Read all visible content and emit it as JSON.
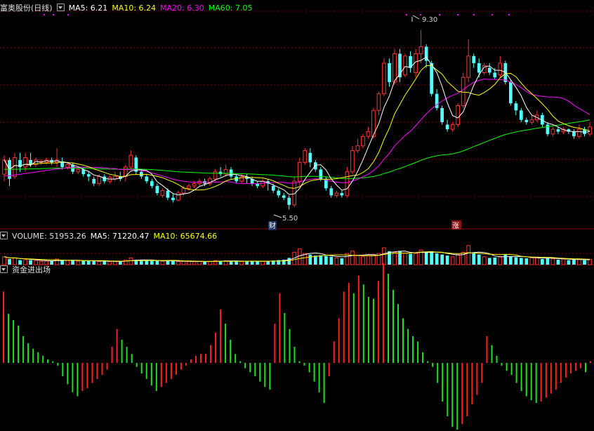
{
  "theme": {
    "up": "#ff3232",
    "down": "#54ffff",
    "ma5": "#ffffff",
    "ma10": "#ffff00",
    "ma20": "#ff00ff",
    "ma60": "#00ff00",
    "grid": "#8b0000",
    "fund_up": "#ff2020",
    "fund_down": "#20e020"
  },
  "header": {
    "title": "富奥股份(日线)",
    "ma5": "MA5: 6.21",
    "ma10": "MA10: 6.24",
    "ma20": "MA20: 6.30",
    "ma60": "MA60: 7.05"
  },
  "volume_header": {
    "title": "VOLUME: 51953.26",
    "ma5": "MA5: 71220.47",
    "ma10": "MA10: 65674.66"
  },
  "fund_header": {
    "title": "资金进出场"
  },
  "chart_data": {
    "type": "candlestick",
    "price_range": [
      5.3,
      9.7
    ],
    "annotations": {
      "high_label": "9.30",
      "low_label": "5.50",
      "badge_cai": "财",
      "badge_zhang": "涨"
    },
    "candles": [
      [
        6.25,
        6.55,
        6.65,
        6.1
      ],
      [
        6.55,
        6.15,
        6.6,
        6.0
      ],
      [
        6.2,
        6.6,
        6.7,
        6.15
      ],
      [
        6.55,
        6.4,
        6.7,
        6.3
      ],
      [
        6.4,
        6.6,
        6.7,
        6.3
      ],
      [
        6.55,
        6.45,
        6.7,
        6.4
      ],
      [
        6.45,
        6.55,
        6.6,
        6.4
      ],
      [
        6.5,
        6.52,
        6.56,
        6.45
      ],
      [
        6.5,
        6.55,
        6.6,
        6.45
      ],
      [
        6.55,
        6.5,
        6.6,
        6.45
      ],
      [
        6.5,
        6.55,
        6.8,
        6.4
      ],
      [
        6.52,
        6.4,
        6.6,
        6.35
      ],
      [
        6.4,
        6.45,
        6.5,
        6.35
      ],
      [
        6.45,
        6.3,
        6.5,
        6.25
      ],
      [
        6.3,
        6.35,
        6.4,
        6.25
      ],
      [
        6.35,
        6.25,
        6.4,
        6.2
      ],
      [
        6.25,
        6.2,
        6.3,
        6.1
      ],
      [
        6.15,
        6.05,
        6.2,
        6.0
      ],
      [
        6.05,
        6.2,
        6.25,
        6.0
      ],
      [
        6.2,
        6.1,
        6.25,
        6.05
      ],
      [
        6.1,
        6.18,
        6.22,
        6.05
      ],
      [
        6.15,
        6.2,
        6.3,
        6.1
      ],
      [
        6.2,
        6.15,
        6.3,
        6.1
      ],
      [
        6.2,
        6.4,
        6.45,
        6.1
      ],
      [
        6.4,
        6.65,
        6.75,
        6.35
      ],
      [
        6.6,
        6.3,
        6.65,
        6.25
      ],
      [
        6.3,
        6.2,
        6.35,
        6.15
      ],
      [
        6.2,
        6.1,
        6.25,
        6.05
      ],
      [
        6.1,
        6.0,
        6.15,
        5.95
      ],
      [
        6.0,
        5.85,
        6.05,
        5.8
      ],
      [
        5.8,
        5.9,
        5.95,
        5.75
      ],
      [
        5.9,
        5.75,
        5.95,
        5.7
      ],
      [
        5.75,
        5.7,
        5.85,
        5.65
      ],
      [
        5.7,
        5.85,
        5.9,
        5.68
      ],
      [
        5.85,
        5.95,
        6.0,
        5.8
      ],
      [
        5.95,
        6.0,
        6.05,
        5.9
      ],
      [
        6.0,
        6.05,
        6.1,
        5.95
      ],
      [
        6.05,
        6.1,
        6.15,
        6.0
      ],
      [
        6.1,
        6.05,
        6.15,
        6.0
      ],
      [
        6.05,
        6.15,
        6.2,
        6.0
      ],
      [
        6.15,
        6.3,
        6.35,
        6.1
      ],
      [
        6.3,
        6.25,
        6.4,
        6.2
      ],
      [
        6.25,
        6.35,
        6.45,
        6.2
      ],
      [
        6.35,
        6.2,
        6.4,
        6.15
      ],
      [
        6.2,
        6.1,
        6.25,
        6.05
      ],
      [
        6.1,
        6.2,
        6.25,
        6.05
      ],
      [
        6.2,
        6.15,
        6.25,
        6.05
      ],
      [
        6.15,
        6.05,
        6.2,
        6.0
      ],
      [
        6.05,
        6.0,
        6.1,
        5.95
      ],
      [
        6.0,
        6.1,
        6.15,
        5.95
      ],
      [
        6.1,
        6.05,
        6.15,
        5.9
      ],
      [
        6.0,
        5.9,
        6.05,
        5.85
      ],
      [
        5.9,
        5.8,
        5.95,
        5.75
      ],
      [
        5.8,
        5.75,
        5.85,
        5.7
      ],
      [
        5.75,
        5.6,
        5.8,
        5.5
      ],
      [
        5.6,
        6.1,
        6.2,
        5.55
      ],
      [
        6.1,
        6.5,
        6.6,
        6.0
      ],
      [
        6.5,
        6.75,
        6.8,
        6.45
      ],
      [
        6.7,
        6.5,
        6.8,
        6.4
      ],
      [
        6.5,
        6.35,
        6.55,
        6.3
      ],
      [
        6.35,
        6.15,
        6.4,
        6.1
      ],
      [
        6.15,
        5.95,
        6.2,
        5.9
      ],
      [
        5.95,
        5.8,
        6.0,
        5.75
      ],
      [
        5.8,
        5.85,
        5.9,
        5.75
      ],
      [
        5.85,
        5.8,
        5.9,
        5.75
      ],
      [
        5.8,
        6.3,
        6.4,
        5.75
      ],
      [
        6.3,
        6.75,
        6.85,
        6.25
      ],
      [
        6.75,
        6.85,
        7.0,
        6.7
      ],
      [
        6.85,
        7.05,
        7.1,
        6.8
      ],
      [
        7.05,
        7.15,
        7.25,
        7.0
      ],
      [
        7.05,
        7.6,
        7.65,
        7.0
      ],
      [
        7.6,
        7.95,
        8.0,
        7.5
      ],
      [
        7.95,
        8.6,
        8.7,
        7.9
      ],
      [
        8.6,
        8.2,
        8.7,
        8.1
      ],
      [
        8.2,
        8.8,
        8.9,
        8.15
      ],
      [
        8.8,
        8.3,
        8.9,
        8.2
      ],
      [
        8.35,
        8.75,
        8.8,
        8.3
      ],
      [
        8.75,
        8.5,
        8.85,
        8.4
      ],
      [
        8.4,
        8.8,
        8.9,
        8.3
      ],
      [
        8.8,
        8.95,
        9.3,
        8.6
      ],
      [
        8.95,
        8.65,
        9.0,
        8.5
      ],
      [
        8.6,
        7.95,
        8.65,
        7.9
      ],
      [
        7.95,
        7.65,
        8.05,
        7.6
      ],
      [
        7.65,
        7.35,
        7.7,
        7.3
      ],
      [
        7.3,
        7.2,
        7.4,
        7.15
      ],
      [
        7.2,
        7.3,
        7.35,
        7.15
      ],
      [
        7.3,
        7.7,
        7.75,
        7.25
      ],
      [
        7.7,
        8.3,
        8.4,
        7.65
      ],
      [
        8.3,
        8.75,
        9.1,
        8.2
      ],
      [
        8.75,
        8.6,
        8.8,
        8.5
      ],
      [
        8.6,
        8.4,
        8.7,
        8.3
      ],
      [
        8.4,
        8.55,
        8.6,
        8.35
      ],
      [
        8.5,
        8.4,
        8.6,
        8.35
      ],
      [
        8.4,
        8.3,
        8.5,
        8.25
      ],
      [
        8.35,
        8.6,
        8.75,
        8.3
      ],
      [
        8.6,
        8.2,
        8.65,
        8.15
      ],
      [
        8.2,
        7.75,
        8.25,
        7.7
      ],
      [
        7.75,
        7.6,
        7.8,
        7.5
      ],
      [
        7.6,
        7.4,
        7.65,
        7.35
      ],
      [
        7.4,
        7.35,
        7.45,
        7.3
      ],
      [
        7.35,
        7.4,
        7.5,
        7.3
      ],
      [
        7.4,
        7.5,
        7.6,
        7.35
      ],
      [
        7.5,
        7.3,
        7.55,
        7.25
      ],
      [
        7.3,
        7.1,
        7.35,
        7.05
      ],
      [
        7.1,
        7.2,
        7.25,
        7.05
      ],
      [
        7.2,
        7.15,
        7.25,
        7.1
      ],
      [
        7.15,
        7.2,
        7.25,
        7.1
      ],
      [
        7.2,
        7.15,
        7.22,
        7.1
      ],
      [
        7.15,
        7.05,
        7.2,
        7.0
      ],
      [
        7.05,
        7.2,
        7.3,
        7.0
      ],
      [
        7.2,
        7.1,
        7.25,
        7.05
      ],
      [
        7.1,
        7.25,
        7.35,
        7.05
      ]
    ],
    "volume": [
      0.35,
      0.25,
      0.3,
      0.2,
      0.22,
      0.2,
      0.18,
      0.15,
      0.16,
      0.17,
      0.25,
      0.2,
      0.18,
      0.2,
      0.15,
      0.17,
      0.16,
      0.18,
      0.14,
      0.15,
      0.14,
      0.13,
      0.14,
      0.2,
      0.3,
      0.22,
      0.18,
      0.17,
      0.16,
      0.2,
      0.15,
      0.17,
      0.15,
      0.14,
      0.15,
      0.14,
      0.13,
      0.14,
      0.13,
      0.15,
      0.18,
      0.16,
      0.17,
      0.15,
      0.16,
      0.14,
      0.15,
      0.16,
      0.14,
      0.15,
      0.16,
      0.18,
      0.2,
      0.22,
      0.3,
      0.55,
      0.7,
      0.5,
      0.45,
      0.4,
      0.42,
      0.38,
      0.35,
      0.3,
      0.28,
      0.5,
      0.6,
      0.4,
      0.35,
      0.4,
      0.45,
      0.5,
      0.75,
      0.6,
      0.55,
      0.58,
      0.52,
      0.48,
      0.5,
      0.65,
      0.55,
      0.6,
      0.5,
      0.45,
      0.4,
      0.35,
      0.45,
      0.55,
      0.85,
      0.5,
      0.45,
      0.35,
      0.3,
      0.32,
      0.35,
      0.45,
      0.38,
      0.33,
      0.3,
      0.28,
      0.3,
      0.32,
      0.25,
      0.3,
      0.26,
      0.22,
      0.25,
      0.2,
      0.22,
      0.24,
      0.2,
      0.23
    ],
    "fund_flow": [
      0.8,
      0.55,
      0.48,
      0.42,
      0.3,
      0.22,
      0.16,
      0.12,
      0.08,
      0.04,
      0.02,
      -0.04,
      -0.2,
      -0.32,
      -0.44,
      -0.5,
      -0.42,
      -0.38,
      -0.3,
      -0.24,
      -0.18,
      -0.1,
      0.18,
      0.38,
      0.26,
      0.18,
      0.1,
      -0.06,
      -0.16,
      -0.24,
      -0.34,
      -0.42,
      -0.36,
      -0.3,
      -0.24,
      -0.18,
      -0.1,
      -0.04,
      0.04,
      0.08,
      0.1,
      0.1,
      0.2,
      0.34,
      0.6,
      0.44,
      0.26,
      0.1,
      0.02,
      -0.08,
      -0.14,
      -0.2,
      -0.28,
      -0.36,
      -0.4,
      0.44,
      0.78,
      0.56,
      0.38,
      0.18,
      0.02,
      -0.04,
      -0.14,
      -0.28,
      -0.44,
      -0.6,
      -0.2,
      0.24,
      0.5,
      0.8,
      0.9,
      0.78,
      0.98,
      0.88,
      0.74,
      0.72,
      0.92,
      1.12,
      1.0,
      0.82,
      0.66,
      0.5,
      0.38,
      0.3,
      0.24,
      0.12,
      0.02,
      -0.06,
      -0.3,
      -0.58,
      -0.8,
      -0.96,
      -1.0,
      -0.92,
      -0.8,
      -0.62,
      -0.48,
      -0.3,
      0.3,
      0.2,
      0.08,
      -0.04,
      -0.12,
      -0.18,
      -0.3,
      -0.42,
      -0.5,
      -0.56,
      -0.6,
      -0.58,
      -0.52,
      -0.46,
      -0.4,
      -0.3,
      -0.22,
      -0.16,
      -0.12,
      -0.08,
      -0.14,
      0.02
    ]
  }
}
